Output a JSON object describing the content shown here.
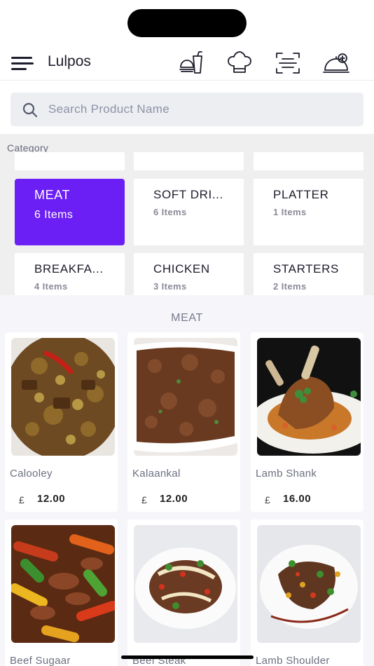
{
  "header": {
    "title": "Lulpos",
    "icons": [
      "menu-icon",
      "meal-icon",
      "chef-hat-icon",
      "scan-icon",
      "serving-dish-add-icon"
    ]
  },
  "search": {
    "placeholder": "Search Product Name"
  },
  "categories": {
    "label": "Category",
    "items": [
      {
        "name": "MEAT",
        "count": "6 Items",
        "active": true
      },
      {
        "name": "SOFT DRI...",
        "count": "6 Items"
      },
      {
        "name": "PLATTER",
        "count": "1 Items"
      },
      {
        "name": "BREAKFA...",
        "count": "4 Items"
      },
      {
        "name": "CHICKEN",
        "count": "3 Items"
      },
      {
        "name": "STARTERS",
        "count": "2 Items"
      }
    ]
  },
  "products": {
    "section_title": "MEAT",
    "currency": "£",
    "items": [
      {
        "name": "Calooley",
        "price": "12.00"
      },
      {
        "name": "Kalaankal",
        "price": "12.00"
      },
      {
        "name": "Lamb Shank",
        "price": "16.00"
      },
      {
        "name": "Beef Sugaar",
        "price": ""
      },
      {
        "name": "Beef Steak",
        "price": ""
      },
      {
        "name": "Lamb Shoulder",
        "price": ""
      }
    ]
  },
  "colors": {
    "accent": "#6c1ff5",
    "background": "#f6f6fa",
    "category_bg": "#efefef"
  }
}
